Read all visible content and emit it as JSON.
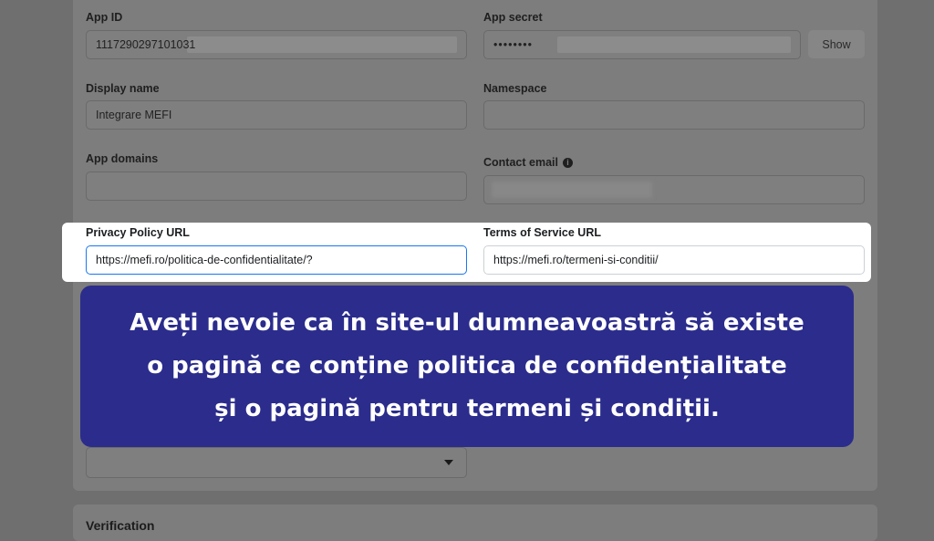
{
  "app_id": {
    "label": "App ID",
    "value": "1117290297101031"
  },
  "app_secret": {
    "label": "App secret",
    "value": "••••••••",
    "show_label": "Show"
  },
  "display_name": {
    "label": "Display name",
    "value": "Integrare MEFI"
  },
  "namespace": {
    "label": "Namespace",
    "value": ""
  },
  "app_domains": {
    "label": "App domains",
    "value": ""
  },
  "contact_email": {
    "label": "Contact email",
    "value": ""
  },
  "privacy_policy": {
    "label": "Privacy Policy URL",
    "value": "https://mefi.ro/politica-de-confidentialitate/?"
  },
  "terms_of_service": {
    "label": "Terms of Service URL",
    "value": "https://mefi.ro/termeni-si-conditii/"
  },
  "banner": {
    "line1": "Aveți nevoie ca în site-ul dumneavoastră să existe",
    "line2": "o pagină ce conține politica de confidențialitate",
    "line3": "și o pagină pentru termeni și condiții."
  },
  "section2": {
    "title": "Verification"
  },
  "colors": {
    "highlight": "#ffffff",
    "banner": "#2b2c8c",
    "focus_border": "#1877f2"
  }
}
